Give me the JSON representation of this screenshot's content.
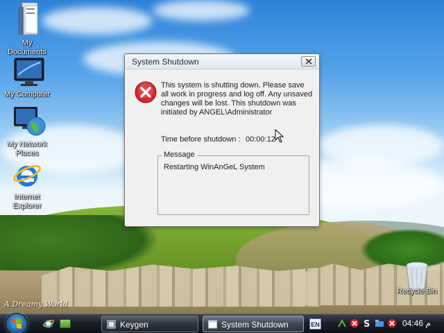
{
  "desktop": {
    "icons": [
      {
        "label_line1": "My",
        "label_line2": "Documents"
      },
      {
        "label_line1": "My Computer",
        "label_line2": ""
      },
      {
        "label_line1": "My Network",
        "label_line2": "Places"
      },
      {
        "label_line1": "Internet",
        "label_line2": "Explorer"
      }
    ],
    "recycle_bin": "Recycle Bin",
    "watermark": "A Dreamy World"
  },
  "dialog": {
    "title": "System Shutdown",
    "message": "This system is shutting down. Please save all work in progress and log off. Any unsaved changes will be lost. This shutdown was initiated by ANGEL\\Administrator",
    "time_label": "Time before shutdown :",
    "time_value": "00:00:12",
    "group_label": "Message",
    "group_text": "Restarting WinAnGeL System",
    "icon": "error-icon"
  },
  "taskbar": {
    "buttons": [
      {
        "label": "Keygen",
        "icon": "keygen-app-icon"
      },
      {
        "label": "System Shutdown",
        "icon": "window-icon"
      }
    ],
    "language": "EN",
    "clock": "04:46 م"
  },
  "colors": {
    "error_red": "#d8242a",
    "taskbar": "#1c2028",
    "titlebar": "#dfe8f1"
  }
}
